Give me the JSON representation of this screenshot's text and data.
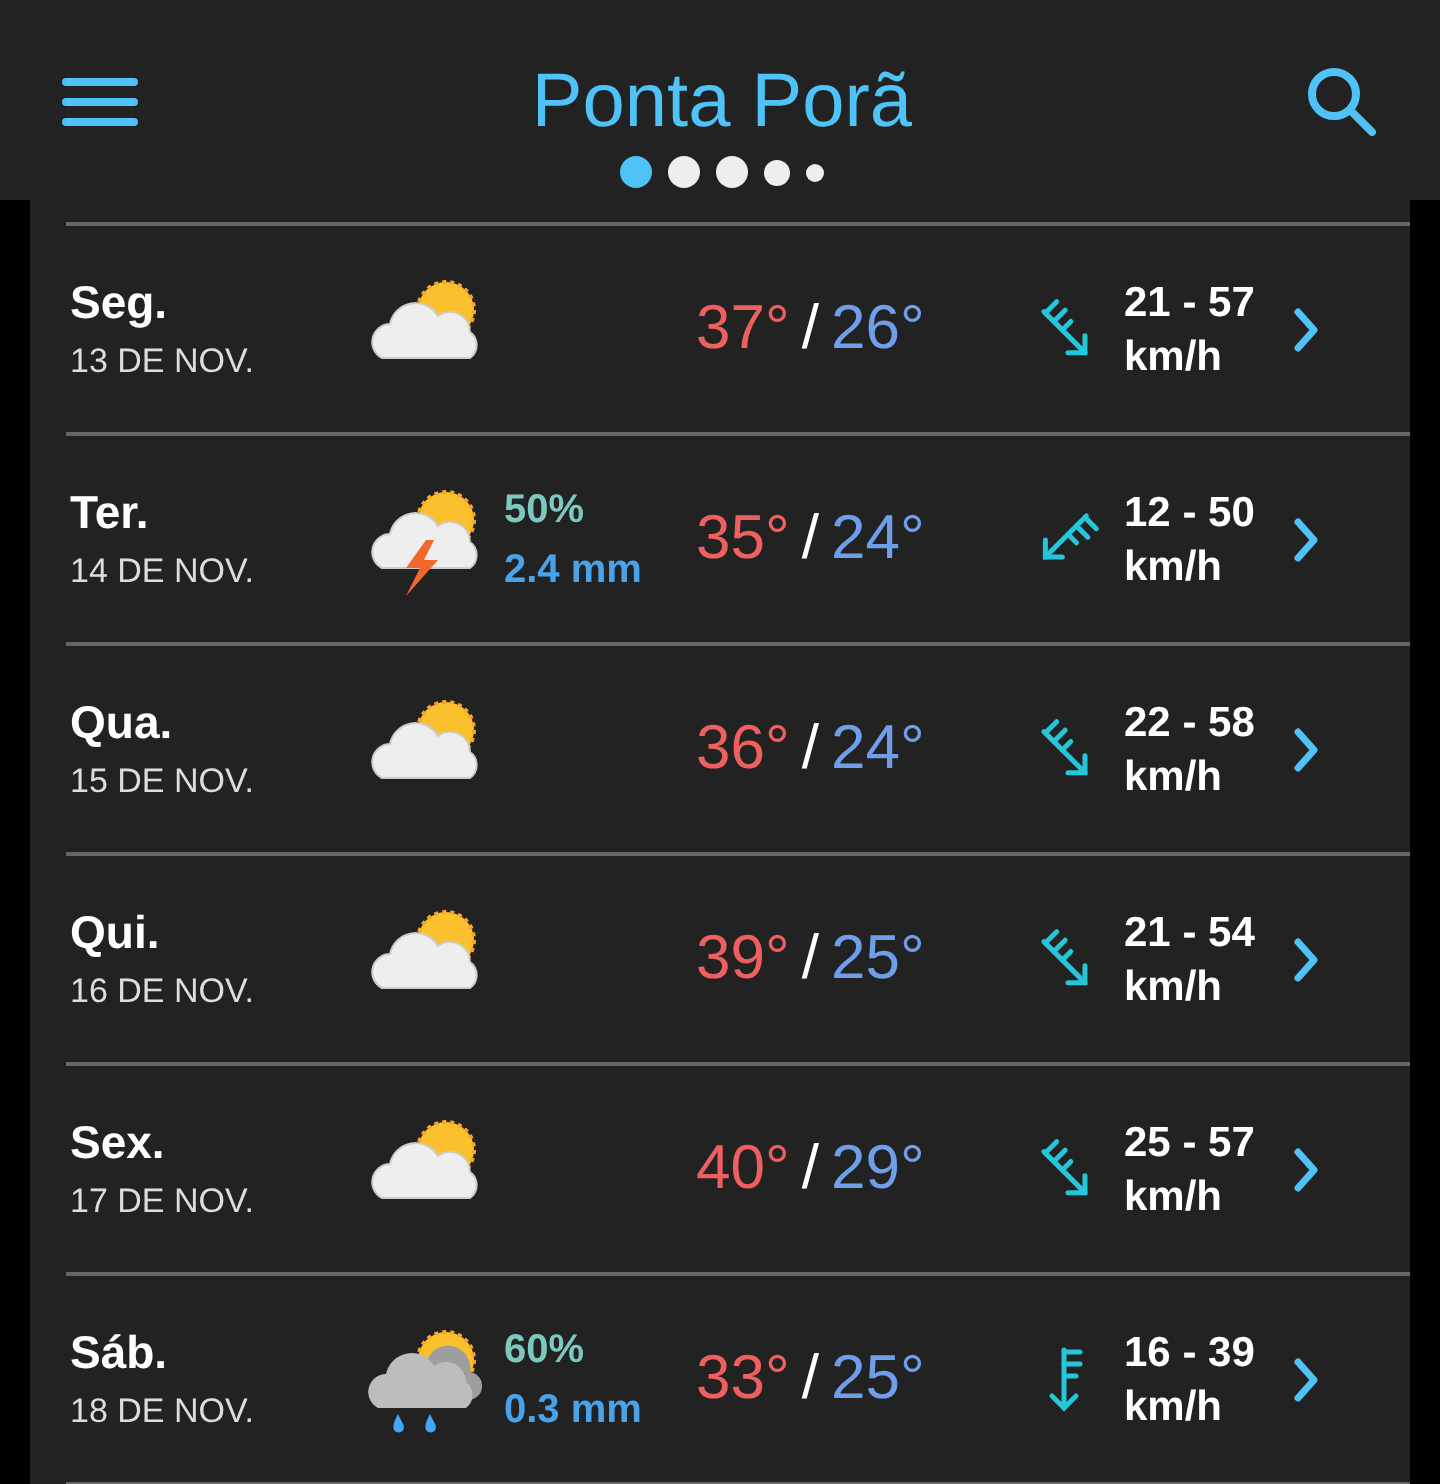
{
  "header": {
    "title": "Ponta Porã",
    "pages": [
      {
        "selected": true
      },
      {
        "selected": false
      },
      {
        "selected": false
      },
      {
        "selected": false
      },
      {
        "selected": false
      }
    ]
  },
  "days": [
    {
      "day": "Seg.",
      "date": "13 DE NOV.",
      "weather_icon": {
        "kind": "partly_cloudy"
      },
      "high": "37°",
      "low": "26°",
      "wind_arrow": {
        "kind": "northwest"
      },
      "wind": "21 - 57",
      "wind_unit": "km/h"
    },
    {
      "day": "Ter.",
      "date": "14 DE NOV.",
      "weather_icon": {
        "kind": "thunderstorm"
      },
      "chance": "50%",
      "amount": "2.4 mm",
      "high": "35°",
      "low": "24°",
      "wind_arrow": {
        "kind": "northeast"
      },
      "wind": "12 - 50",
      "wind_unit": "km/h"
    },
    {
      "day": "Qua.",
      "date": "15 DE NOV.",
      "weather_icon": {
        "kind": "partly_cloudy"
      },
      "high": "36°",
      "low": "24°",
      "wind_arrow": {
        "kind": "northwest"
      },
      "wind": "22 - 58",
      "wind_unit": "km/h"
    },
    {
      "day": "Qui.",
      "date": "16 DE NOV.",
      "weather_icon": {
        "kind": "partly_cloudy"
      },
      "high": "39°",
      "low": "25°",
      "wind_arrow": {
        "kind": "northwest"
      },
      "wind": "21 - 54",
      "wind_unit": "km/h"
    },
    {
      "day": "Sex.",
      "date": "17 DE NOV.",
      "weather_icon": {
        "kind": "partly_cloudy"
      },
      "high": "40°",
      "low": "29°",
      "wind_arrow": {
        "kind": "northwest"
      },
      "wind": "25 - 57",
      "wind_unit": "km/h"
    },
    {
      "day": "Sáb.",
      "date": "18 DE NOV.",
      "weather_icon": {
        "kind": "rain"
      },
      "chance": "60%",
      "amount": "0.3 mm",
      "high": "33°",
      "low": "25°",
      "wind_arrow": {
        "kind": "north"
      },
      "wind": "16 - 39",
      "wind_unit": "km/h"
    }
  ],
  "separator": "/"
}
